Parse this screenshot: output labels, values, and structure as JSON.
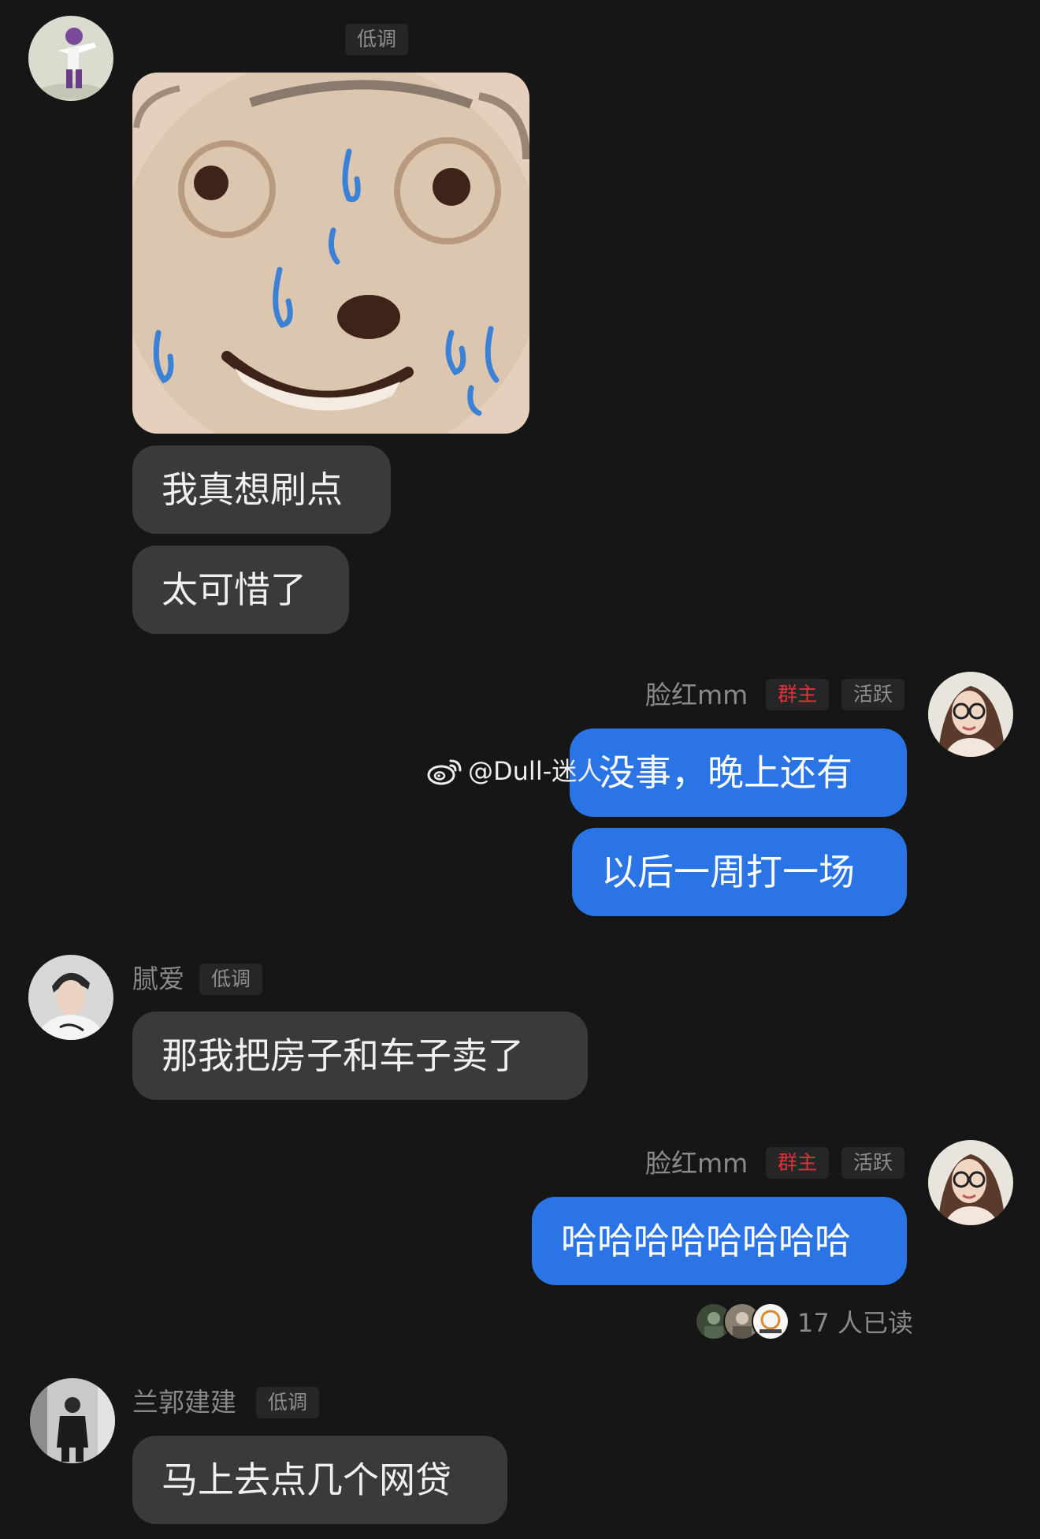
{
  "messages": {
    "m1": {
      "tag": "低调",
      "sticker": "sweating-dog-sticker",
      "bubbles": [
        "我真想刷点",
        "太可惜了"
      ]
    },
    "m2": {
      "name": "脸红mm",
      "owner_tag": "群主",
      "active_tag": "活跃",
      "bubbles": [
        "没事，晚上还有",
        "以后一周打一场"
      ]
    },
    "m3": {
      "name": "腻爱",
      "tag": "低调",
      "bubbles": [
        "那我把房子和车子卖了"
      ]
    },
    "m4": {
      "name": "脸红mm",
      "owner_tag": "群主",
      "active_tag": "活跃",
      "bubbles": [
        "哈哈哈哈哈哈哈哈"
      ],
      "read_status": "17 人已读"
    },
    "m5": {
      "name": "兰郭建建",
      "tag": "低调",
      "bubbles": [
        "马上去点几个网贷"
      ]
    }
  },
  "watermark": {
    "text": "@Dull-迷人",
    "icon": "weibo-icon"
  },
  "colors": {
    "background": "#161616",
    "bubble_left": "#3a3a3a",
    "bubble_right": "#2a74e6",
    "owner_tag": "#e0303a",
    "muted_text": "#8a8a8a"
  }
}
